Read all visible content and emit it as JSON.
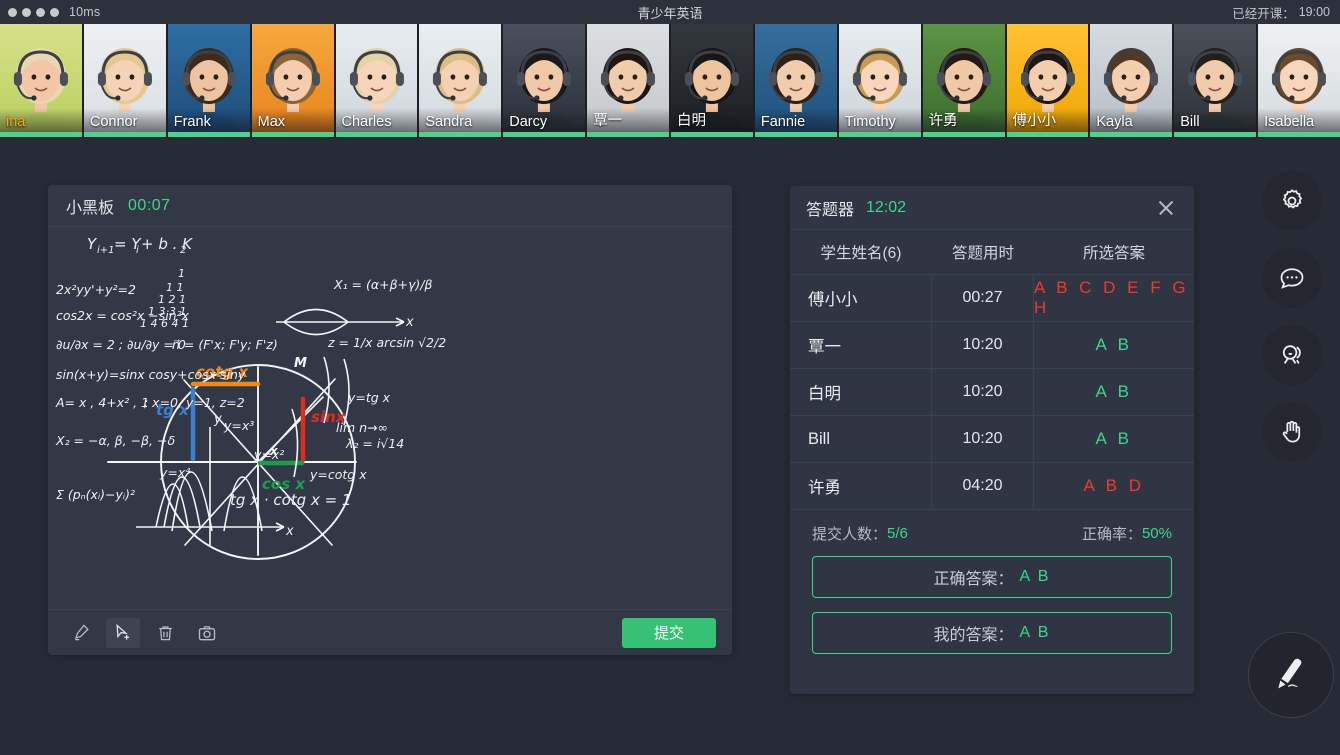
{
  "topbar": {
    "latency": "10ms",
    "title": "青少年英语",
    "session_label": "已经开课：",
    "session_time": "19:00",
    "dot_count": 4
  },
  "students": [
    {
      "name": "ina",
      "highlight": true,
      "skin": "#f2c6a6",
      "bg1": "#b9cf5c",
      "bg2": "#d8e08a",
      "hair": "#e8d7b0",
      "type": "girl"
    },
    {
      "name": "Connor",
      "highlight": false,
      "skin": "#f4d3b6",
      "bg1": "#d8dde2",
      "bg2": "#eef1f4",
      "hair": "#e3c98f",
      "type": "woman"
    },
    {
      "name": "Frank",
      "highlight": false,
      "skin": "#edc3a2",
      "bg1": "#1d4b78",
      "bg2": "#2e6fa3",
      "hair": "#3c2a1c",
      "type": "glasses"
    },
    {
      "name": "Max",
      "highlight": false,
      "skin": "#f3cdae",
      "bg1": "#e8821c",
      "bg2": "#f5a93e",
      "hair": "#8c6239",
      "type": "boy"
    },
    {
      "name": "Charles",
      "highlight": false,
      "skin": "#f6d5bb",
      "bg1": "#cfd6dc",
      "bg2": "#e7ecf0",
      "hair": "#e5d3a8",
      "type": "girl"
    },
    {
      "name": "Sandra",
      "highlight": false,
      "skin": "#f5d0b2",
      "bg1": "#d2d8de",
      "bg2": "#e9eef2",
      "hair": "#d9bf84",
      "type": "girl"
    },
    {
      "name": "Darcy",
      "highlight": false,
      "skin": "#f0c9a8",
      "bg1": "#2a2f38",
      "bg2": "#4a515d",
      "hair": "#1a1a1a",
      "type": "beanie"
    },
    {
      "name": "覃一",
      "highlight": false,
      "skin": "#f0cbac",
      "bg1": "#c5c8cb",
      "bg2": "#dcdfe2",
      "hair": "#20160f",
      "type": "cn-girl"
    },
    {
      "name": "白明",
      "highlight": false,
      "skin": "#eec49f",
      "bg1": "#1b1d22",
      "bg2": "#34383f",
      "hair": "#171717",
      "type": "cn-boy"
    },
    {
      "name": "Fannie",
      "highlight": false,
      "skin": "#f2cdad",
      "bg1": "#1f4f7a",
      "bg2": "#356f9e",
      "hair": "#2d2018",
      "type": "cn-boy2"
    },
    {
      "name": "Timothy",
      "highlight": false,
      "skin": "#f7d6bb",
      "bg1": "#cdd4da",
      "bg2": "#e7ecef",
      "hair": "#c99b52",
      "type": "girl"
    },
    {
      "name": "许勇",
      "highlight": false,
      "skin": "#efc8a6",
      "bg1": "#3a6b2e",
      "bg2": "#5d9444",
      "hair": "#241a12",
      "type": "cn-boy"
    },
    {
      "name": "傅小小",
      "highlight": false,
      "skin": "#f4cfae",
      "bg1": "#f0a500",
      "bg2": "#ffc233",
      "hair": "#201510",
      "type": "cn-girl"
    },
    {
      "name": "Kayla",
      "highlight": false,
      "skin": "#f3cfb0",
      "bg1": "#b4bcc4",
      "bg2": "#d6dce1",
      "hair": "#503823",
      "type": "girl"
    },
    {
      "name": "Bill",
      "highlight": false,
      "skin": "#f0cbac",
      "bg1": "#2d3138",
      "bg2": "#4b515a",
      "hair": "#23201c",
      "type": "beanie"
    },
    {
      "name": "Isabella",
      "highlight": false,
      "skin": "#f6d6bc",
      "bg1": "#d5dade",
      "bg2": "#edf1f3",
      "hair": "#6b4a2d",
      "type": "girl"
    }
  ],
  "whiteboard": {
    "title": "小黑板",
    "timer": "00:07",
    "submit_label": "提交",
    "tools": [
      {
        "name": "pen-icon",
        "active": false
      },
      {
        "name": "cursor-add-icon",
        "active": true
      },
      {
        "name": "trash-icon",
        "active": false
      },
      {
        "name": "camera-icon",
        "active": false
      }
    ],
    "board_text": {
      "main_formula": "Y(i+1) = Yi + b·K2",
      "items": [
        "2x²yy' + y² = 2",
        "cos2x = cos²x − sin²x",
        "∂u/∂x = 2 ; ∂u/∂y = 0",
        "n⃗ = (Fx'; Fy'; Fz')",
        "sin(x+y) = sinx cosy + cosx siny",
        "x=0, y=1, z=2",
        "y = x³",
        "y = x²",
        "y = x⁴",
        "y = tg x",
        "y = cotg x",
        "tg x · cotg x = 1",
        "z = 1/x arcsin (√2 / 2)",
        "λ2 = i√14"
      ],
      "circle_labels": [
        "cotg x",
        "tg x",
        "sin x",
        "cos x",
        "M",
        "x"
      ]
    }
  },
  "answer_panel": {
    "title": "答题器",
    "timer": "12:02",
    "columns": [
      "学生姓名(6)",
      "答题用时",
      "所选答案"
    ],
    "rows": [
      {
        "name": "傅小小",
        "time": "00:27",
        "answer": "A B C D E F G H",
        "correct": false
      },
      {
        "name": "覃一",
        "time": "10:20",
        "answer": "A B",
        "correct": true
      },
      {
        "name": "白明",
        "time": "10:20",
        "answer": "A B",
        "correct": true
      },
      {
        "name": "Bill",
        "time": "10:20",
        "answer": "A B",
        "correct": true
      },
      {
        "name": "许勇",
        "time": "04:20",
        "answer": "A B D",
        "correct": false
      }
    ],
    "submitted_label": "提交人数：",
    "submitted_value": "5/6",
    "accuracy_label": "正确率：",
    "accuracy_value": "50%",
    "correct_answer_label": "正确答案：",
    "correct_answer_value": "A B",
    "my_answer_label": "我的答案：",
    "my_answer_value": "A B"
  },
  "rail": [
    {
      "icon": "gear-icon"
    },
    {
      "icon": "chat-bubble-icon"
    },
    {
      "icon": "people-icon"
    },
    {
      "icon": "raise-hand-icon"
    }
  ],
  "pen_button": {
    "icon": "pencil-icon"
  },
  "colors": {
    "accent_green": "#3fd687",
    "submit_green": "#37c177",
    "error_red": "#f0392b",
    "highlight_orange": "#f0a81c",
    "panel_bg": "#2f3542",
    "board_bg": "#333846",
    "page_bg": "#272b36"
  }
}
